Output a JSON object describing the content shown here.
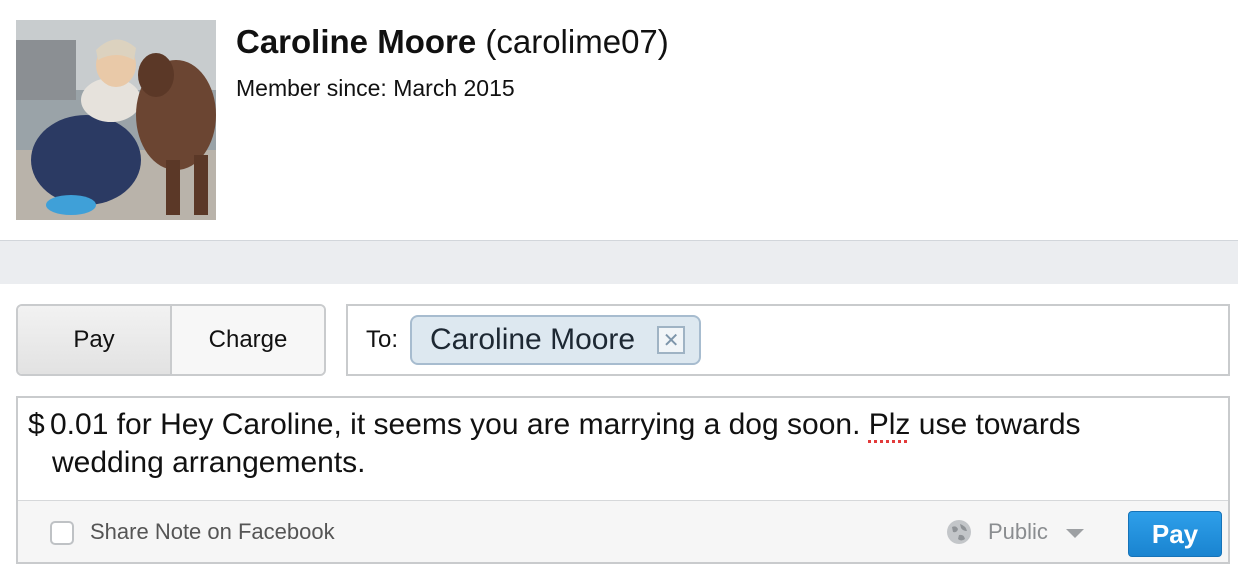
{
  "profile": {
    "full_name": "Caroline Moore",
    "username": "(carolime07)",
    "member_since": "Member since: March 2015"
  },
  "toggle": {
    "pay_label": "Pay",
    "charge_label": "Charge",
    "selected": "Pay"
  },
  "recipient": {
    "to_label": "To:",
    "chip_name": "Caroline Moore",
    "remove_icon": "close-x-icon"
  },
  "note": {
    "currency_symbol": "$",
    "amount": "0.01",
    "text_before_flagged": " for Hey Caroline, it seems you are marrying a dog soon. ",
    "flagged_word": "Plz",
    "text_after_flagged": " use towards",
    "second_line": "wedding arrangements."
  },
  "footer": {
    "share_label": "Share Note on Facebook",
    "share_checked": false,
    "privacy_label": "Public",
    "privacy_icon": "globe-icon",
    "submit_label": "Pay"
  },
  "colors": {
    "accent": "#1a84d0",
    "chip_background": "#dde8f0",
    "divider_band": "#ebedf0"
  }
}
